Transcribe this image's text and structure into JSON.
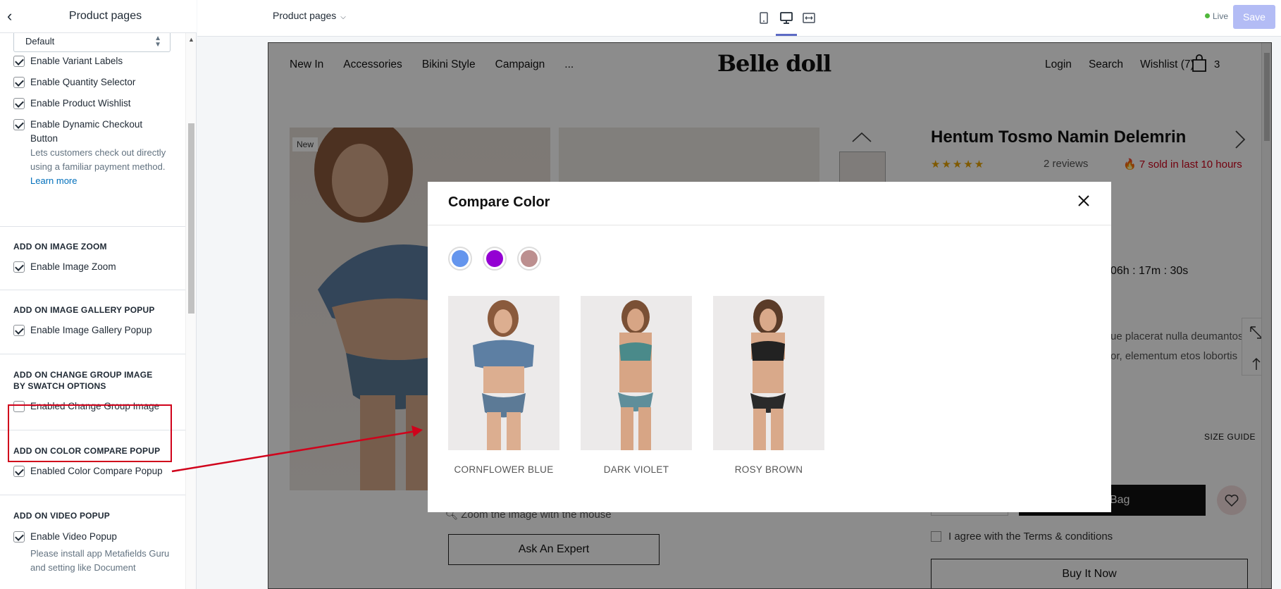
{
  "sidebar": {
    "title": "Product pages",
    "select_value": "Default",
    "items": [
      {
        "label": "Enable Variant Labels",
        "checked": true
      },
      {
        "label": "Enable Quantity Selector",
        "checked": true
      },
      {
        "label": "Enable Product Wishlist",
        "checked": true
      },
      {
        "label": "Enable Dynamic Checkout Button",
        "checked": true
      }
    ],
    "dynamic_help": "Lets customers check out directly using a familiar payment method.",
    "learn_more": "Learn more",
    "sections": {
      "image_zoom": {
        "title": "ADD ON IMAGE ZOOM",
        "label": "Enable Image Zoom"
      },
      "gallery": {
        "title": "ADD ON IMAGE GALLERY POPUP",
        "label": "Enable Image Gallery Popup"
      },
      "group_image": {
        "title": "ADD ON CHANGE GROUP IMAGE BY SWATCH OPTIONS",
        "label": "Enabled Change Group Image"
      },
      "color_compare": {
        "title": "ADD ON COLOR COMPARE POPUP",
        "label": "Enabled Color Compare Popup"
      },
      "video": {
        "title": "ADD ON VIDEO POPUP",
        "label": "Enable Video Popup",
        "help": "Please install app Metafields Guru and setting like Document"
      }
    }
  },
  "topbar": {
    "page_select": "Product pages",
    "live": "Live",
    "save": "Save"
  },
  "store": {
    "nav_left": [
      "New In",
      "Accessories",
      "Bikini Style",
      "Campaign",
      "..."
    ],
    "logo": "Belle doll",
    "nav_right": [
      "Login",
      "Search",
      "Wishlist (7)"
    ],
    "bag_count": "3",
    "badge_new": "New",
    "product_title": "Hentum Tosmo Namin Delemrin",
    "stars": "★★★★★",
    "reviews": "2 reviews",
    "sold": "7 sold in last 10 hours",
    "timer": "06h : 17m : 30s",
    "desc1": "ue placerat nulla deumantos",
    "desc2": "or, elementum etos lobortis",
    "size_guide": "SIZE GUIDE",
    "add_to_bag": "To Bag",
    "zoom_text": "Zoom the image with the mouse",
    "ask_expert": "Ask An Expert",
    "agree": "I agree with the Terms & conditions",
    "buy_now": "Buy It Now"
  },
  "modal": {
    "title": "Compare Color",
    "swatches": [
      {
        "name": "Cornflower Blue",
        "color": "#6495ed"
      },
      {
        "name": "Dark Violet",
        "color": "#9400d3"
      },
      {
        "name": "Rosy Brown",
        "color": "#bc8f8f"
      }
    ],
    "products": [
      {
        "name": "CORNFLOWER BLUE"
      },
      {
        "name": "DARK VIOLET"
      },
      {
        "name": "ROSY BROWN"
      }
    ]
  },
  "colors": {
    "accent": "#5c6ac4",
    "save_disabled": "#b3bcf5",
    "highlight": "#d0021b"
  }
}
